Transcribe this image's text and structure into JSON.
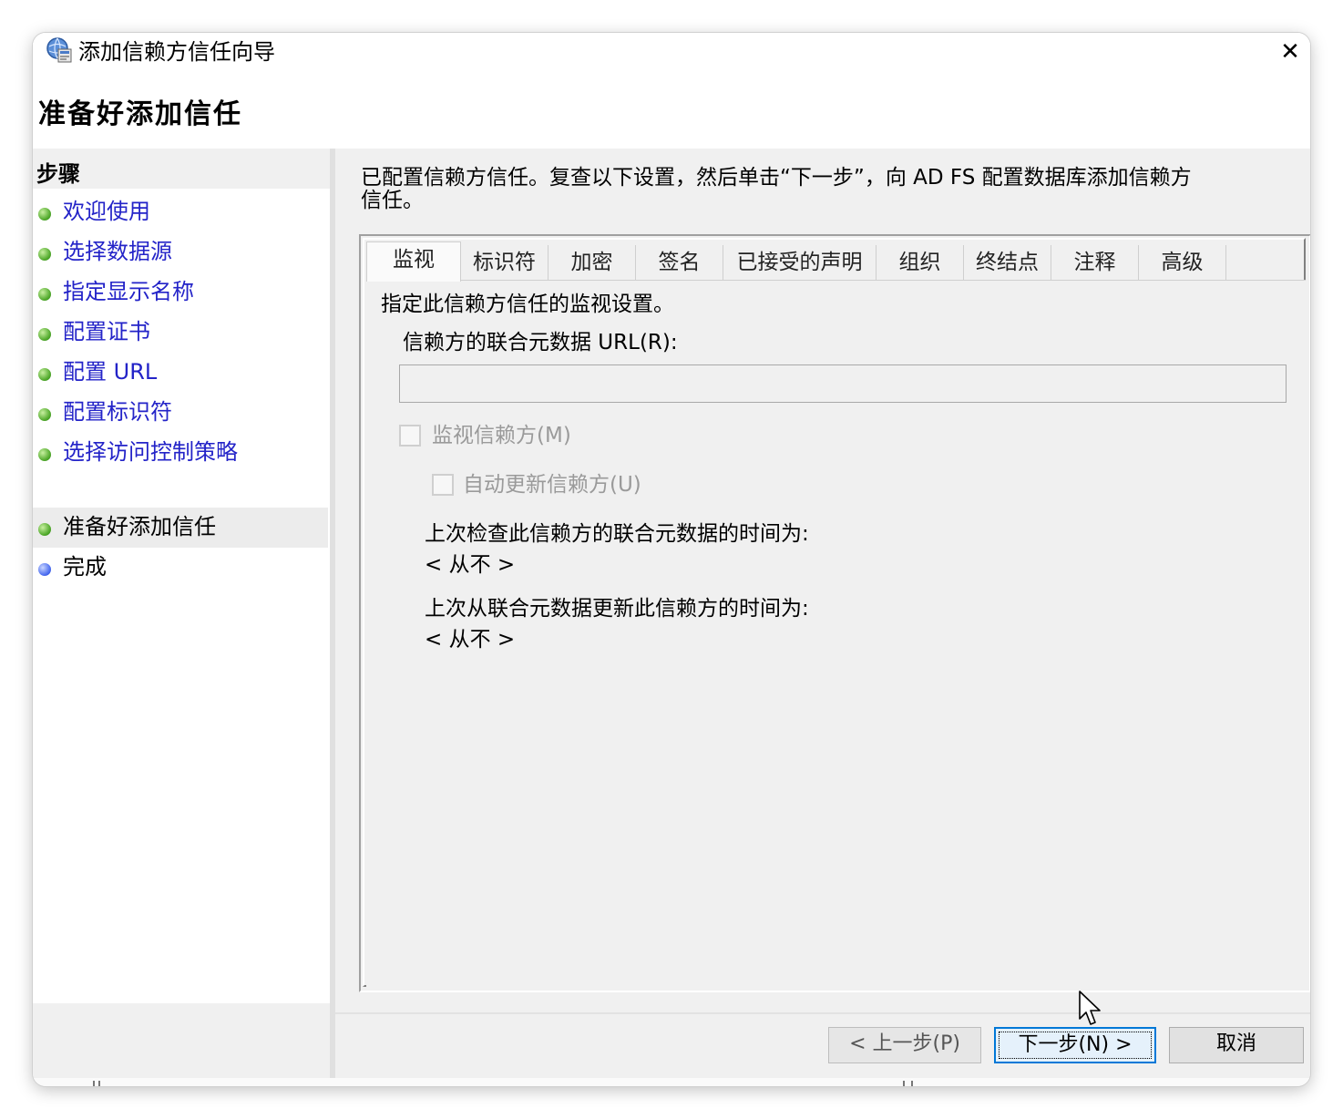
{
  "window": {
    "title": "添加信赖方信任向导",
    "close_glyph": "✕"
  },
  "header": {
    "page_title": "准备好添加信任"
  },
  "sidebar": {
    "heading": "步骤",
    "items": [
      {
        "label": "欢迎使用",
        "status": "done"
      },
      {
        "label": "选择数据源",
        "status": "done"
      },
      {
        "label": "指定显示名称",
        "status": "done"
      },
      {
        "label": "配置证书",
        "status": "done"
      },
      {
        "label": "配置 URL",
        "status": "done"
      },
      {
        "label": "配置标识符",
        "status": "done"
      },
      {
        "label": "选择访问控制策略",
        "status": "done"
      },
      {
        "label": "准备好添加信任",
        "status": "current"
      },
      {
        "label": "完成",
        "status": "pending"
      }
    ]
  },
  "content": {
    "instruction": "已配置信赖方信任。复查以下设置，然后单击“下一步”，向 AD FS 配置数据库添加信赖方信任。",
    "tabs": [
      {
        "label": "监视",
        "active": true
      },
      {
        "label": "标识符",
        "active": false
      },
      {
        "label": "加密",
        "active": false
      },
      {
        "label": "签名",
        "active": false
      },
      {
        "label": "已接受的声明",
        "active": false
      },
      {
        "label": "组织",
        "active": false
      },
      {
        "label": "终结点",
        "active": false
      },
      {
        "label": "注释",
        "active": false
      },
      {
        "label": "高级",
        "active": false
      }
    ],
    "monitoring": {
      "description": "指定此信赖方信任的监视设置。",
      "url_label": "信赖方的联合元数据 URL(R):",
      "url_value": "",
      "monitor_checkbox_label": "监视信赖方(M)",
      "monitor_checked": false,
      "auto_update_checkbox_label": "自动更新信赖方(U)",
      "auto_update_checked": false,
      "last_checked_label": "上次检查此信赖方的联合元数据的时间为:",
      "last_checked_value": "< 从不 >",
      "last_updated_label": "上次从联合元数据更新此信赖方的时间为:",
      "last_updated_value": "< 从不 >"
    }
  },
  "buttons": {
    "prev": "< 上一步(P)",
    "next": "下一步(N) >",
    "cancel": "取消"
  },
  "icons": {
    "app": "trust-wizard-icon",
    "close": "close-icon",
    "step_done": "green-dot-icon",
    "step_pending": "blue-dot-icon",
    "cursor": "mouse-pointer-icon"
  },
  "colors": {
    "link": "#2323c8",
    "done_dot": "#4fa82a",
    "pending_dot": "#4a6cf0",
    "default_button_border": "#0078d7"
  }
}
